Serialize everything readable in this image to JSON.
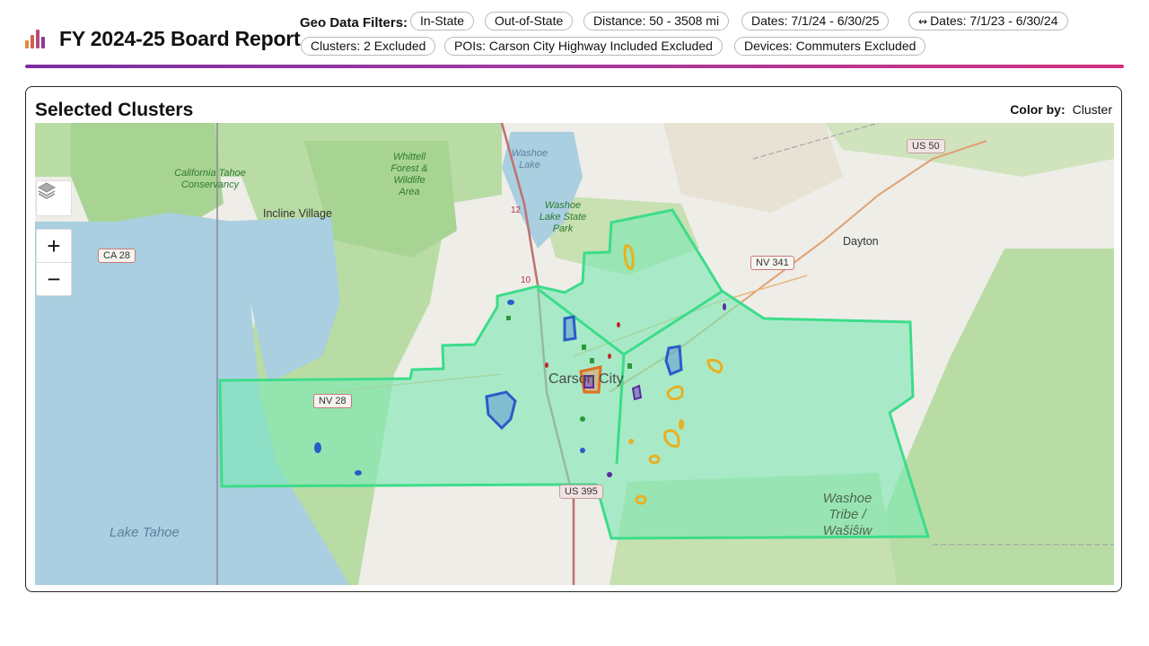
{
  "header": {
    "title": "FY 2024-25 Board Report",
    "brand_icon": "bar-chart-icon",
    "filters_label": "Geo Data Filters:",
    "filters": [
      "In-State",
      "Out-of-State",
      "Distance: 50 - 3508 mi",
      "Dates: 7/1/24 - 6/30/25",
      "Dates: 7/1/23 - 6/30/24",
      "Clusters: 2 Excluded",
      "POIs: Carson City Highway Included Excluded",
      "Devices: Commuters Excluded"
    ],
    "compare_icon": "link-icon",
    "accent_colors": [
      "#7b2fa0",
      "#d2317e"
    ]
  },
  "card": {
    "title": "Selected Clusters",
    "color_by_label": "Color by:",
    "color_by_value": "Cluster"
  },
  "map": {
    "controls": {
      "layers": "layers-icon",
      "zoom_in": "+",
      "zoom_out": "−"
    },
    "labels": {
      "incline_village": "Incline Village",
      "ca28": "CA 28",
      "nv28": "NV 28",
      "nv341": "NV 341",
      "us50": "US 50",
      "us395": "US 395",
      "dayton": "Dayton",
      "carson_city": "Carson City",
      "lake_tahoe": "Lake Tahoe",
      "washoe_lake": "Washoe Lake",
      "washoe_lake_state_park": "Washoe Lake State Park",
      "whittell_forest": "Whittell Forest & Wildlife Area",
      "california_tahoe_conservancy": "California Tahoe Conservancy",
      "washoe_tribe": "Washoe Tribe / Wašiŝiw",
      "route_12": "12",
      "route_10": "10"
    },
    "colors": {
      "water": "#a9cfe0",
      "forest": "#b9dca4",
      "land": "#eeede8",
      "selection_fill": "#7de8b4",
      "selection_stroke": "#3ddc8a",
      "cluster_blue": "#2a5cc9",
      "cluster_purple": "#5b2aa0",
      "cluster_orange": "#e0701c",
      "cluster_yellow": "#e8b020",
      "cluster_green": "#2a9a3a",
      "cluster_red": "#c0282a"
    }
  }
}
